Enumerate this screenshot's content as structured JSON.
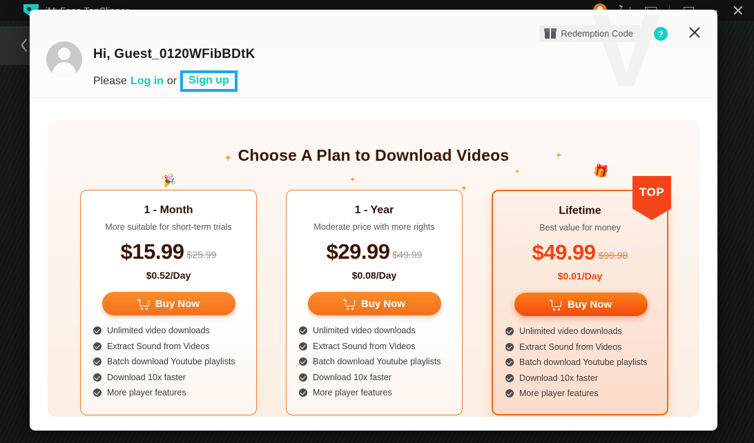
{
  "background_window": {
    "app_title": "iMyFone TopClipper",
    "logo_icon": "play-logo-icon",
    "back_icon": "back-chevron-icon",
    "titlebar_icons": [
      "user-avatar-icon",
      "cart-icon",
      "mail-icon",
      "restore-icon",
      "minimize-icon",
      "close-icon"
    ]
  },
  "modal": {
    "header": {
      "avatar_icon": "user-avatar-icon",
      "greeting": "Hi, Guest_0120WFibBDtK",
      "please_text": "Please",
      "login_label": "Log in",
      "or_text": "or",
      "signup_label": "Sign up",
      "watermark": "V",
      "redemption_label": "Redemption Code",
      "redemption_icon": "gift-icon",
      "help_label": "?",
      "help_icon": "help-circle-icon",
      "close_icon": "close-icon"
    },
    "plans_title": "Choose A Plan to Download Videos",
    "buy_label": "Buy Now",
    "cart_icon": "shopping-cart-icon",
    "top_badge": "TOP",
    "cards": [
      {
        "title": "1 - Month",
        "subtitle": "More suitable for short-term trials",
        "price": "$15.99",
        "old_price": "$25.99",
        "per_day": "$0.52/Day",
        "features": [
          "Unlimited video downloads",
          "Extract Sound from Videos",
          "Batch download Youtube playlists",
          "Download 10x faster",
          "More player features"
        ]
      },
      {
        "title": "1 - Year",
        "subtitle": "Moderate price with more rights",
        "price": "$29.99",
        "old_price": "$49.99",
        "per_day": "$0.08/Day",
        "features": [
          "Unlimited video downloads",
          "Extract Sound from Videos",
          "Batch download Youtube playlists",
          "Download 10x faster",
          "More player features"
        ]
      },
      {
        "title": "Lifetime",
        "subtitle": "Best value for money",
        "price": "$49.99",
        "old_price": "$99.98",
        "per_day": "$0.01/Day",
        "features": [
          "Unlimited video downloads",
          "Extract Sound from Videos",
          "Batch download Youtube playlists",
          "Download 10x faster",
          "More player features"
        ]
      }
    ]
  },
  "colors": {
    "accent_orange": "#f4701d",
    "featured_red": "#f4420f",
    "teal_link": "#15c8c0",
    "highlight_blue": "#17a9f0",
    "title_brown": "#3a1606"
  }
}
